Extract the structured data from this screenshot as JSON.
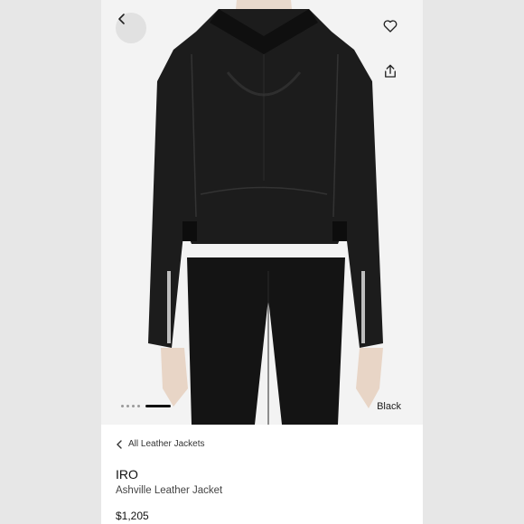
{
  "product": {
    "breadcrumb": "All Leather Jackets",
    "brand": "IRO",
    "name": "Ashville Leather Jacket",
    "price": "$1,205",
    "color": "Black"
  },
  "gallery": {
    "image_count": 5,
    "active_index": 5
  },
  "icons": {
    "back": "chevron-left-icon",
    "favorite": "heart-icon",
    "share": "share-icon"
  },
  "colors": {
    "background": "#e6e6e6",
    "accent": "#111111"
  }
}
